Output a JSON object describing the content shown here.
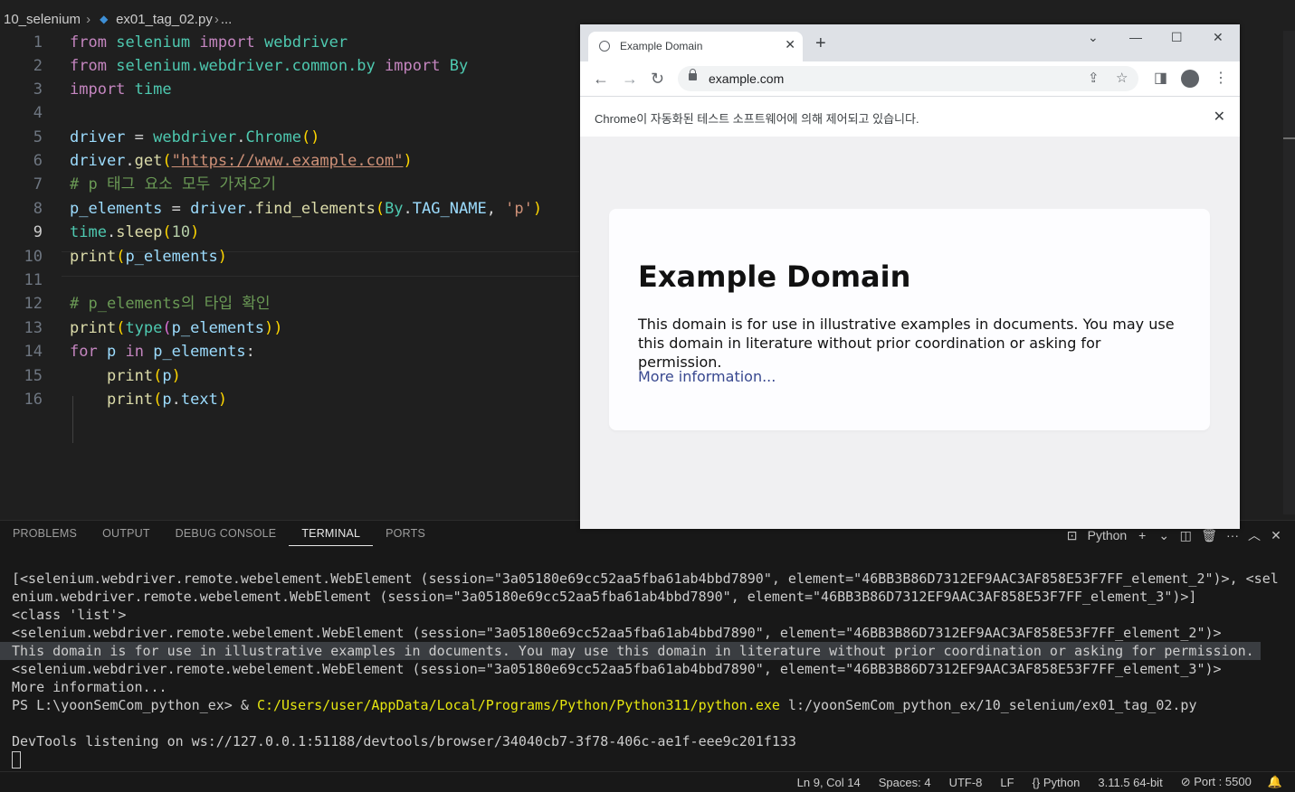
{
  "breadcrumb": {
    "folder": "10_selenium",
    "file": "ex01_tag_02.py",
    "more": "..."
  },
  "code": {
    "line_numbers": [
      "1",
      "2",
      "3",
      "4",
      "5",
      "6",
      "7",
      "8",
      "9",
      "10",
      "11",
      "12",
      "13",
      "14",
      "15",
      "16"
    ],
    "active_line": "9",
    "l1": [
      "from",
      "selenium",
      "import",
      "webdriver"
    ],
    "l2": [
      "from",
      "selenium.webdriver.common.by",
      "import",
      "By"
    ],
    "l3": [
      "import",
      "time"
    ],
    "l5": [
      "driver",
      " = ",
      "webdriver",
      ".",
      "Chrome",
      "()"
    ],
    "l6": [
      "driver",
      ".",
      "get",
      "(",
      "\"https://www.example.com\"",
      ")"
    ],
    "l7": "# p 태그 요소 모두 가져오기",
    "l8": [
      "p_elements",
      " = ",
      "driver",
      ".",
      "find_elements",
      "(",
      "By",
      ".",
      "TAG_NAME",
      ", ",
      "'p'",
      ")"
    ],
    "l9": [
      "time",
      ".",
      "sleep",
      "(",
      "10",
      ")"
    ],
    "l10": [
      "print",
      "(",
      "p_elements",
      ")"
    ],
    "l12": "# p_elements의 타입 확인",
    "l13": [
      "print",
      "(",
      "type",
      "(",
      "p_elements",
      "))"
    ],
    "l14": [
      "for",
      "p",
      "in",
      "p_elements",
      ":"
    ],
    "l15": [
      "print",
      "(",
      "p",
      ")"
    ],
    "l16": [
      "print",
      "(",
      "p",
      ".",
      "text",
      ")"
    ]
  },
  "browser": {
    "tab_title": "Example Domain",
    "url": "example.com",
    "infobar_text": "Chrome이 자동화된 테스트 소프트웨어에 의해 제어되고 있습니다.",
    "page": {
      "heading": "Example Domain",
      "body": "This domain is for use in illustrative examples in documents. You may use this domain in literature without prior coordination or asking for permission.",
      "link": "More information..."
    }
  },
  "panel": {
    "tabs": [
      "PROBLEMS",
      "OUTPUT",
      "DEBUG CONSOLE",
      "TERMINAL",
      "PORTS"
    ],
    "active_tab": "TERMINAL",
    "shell_label": "Python"
  },
  "terminal": {
    "line1": "[<selenium.webdriver.remote.webelement.WebElement (session=\"3a05180e69cc52aa5fba61ab4bbd7890\", element=\"46BB3B86D7312EF9AAC3AF858E53F7FF_element_2\")>, <sel",
    "line2": "enium.webdriver.remote.webelement.WebElement (session=\"3a05180e69cc52aa5fba61ab4bbd7890\", element=\"46BB3B86D7312EF9AAC3AF858E53F7FF_element_3\")>]",
    "line3": "<class 'list'>",
    "line4": "<selenium.webdriver.remote.webelement.WebElement (session=\"3a05180e69cc52aa5fba61ab4bbd7890\", element=\"46BB3B86D7312EF9AAC3AF858E53F7FF_element_2\")>",
    "line5": "This domain is for use in illustrative examples in documents. You may use this domain in literature without prior coordination or asking for permission.",
    "line6": "<selenium.webdriver.remote.webelement.WebElement (session=\"3a05180e69cc52aa5fba61ab4bbd7890\", element=\"46BB3B86D7312EF9AAC3AF858E53F7FF_element_3\")>",
    "line7": "More information...",
    "prompt": "PS L:\\yoonSemCom_python_ex> & ",
    "exe": "C:/Users/user/AppData/Local/Programs/Python/Python311/python.exe",
    "script": " l:/yoonSemCom_python_ex/10_selenium/ex01_tag_02.py",
    "devtools": "DevTools listening on ws://127.0.0.1:51188/devtools/browser/34040cb7-3f78-406c-ae1f-eee9c201f133"
  },
  "status": {
    "position": "Ln 9, Col 14",
    "spaces": "Spaces: 4",
    "encoding": "UTF-8",
    "eol": "LF",
    "language": "Python",
    "interpreter": "3.11.5 64-bit",
    "port": "Port : 5500"
  },
  "colors": {
    "editor_bg": "#1f1f1f",
    "keyword": "#c586c0",
    "function": "#dcdcaa",
    "string": "#ce9178",
    "class": "#4ec9b0",
    "comment": "#6a9955",
    "link": "#38488f"
  }
}
